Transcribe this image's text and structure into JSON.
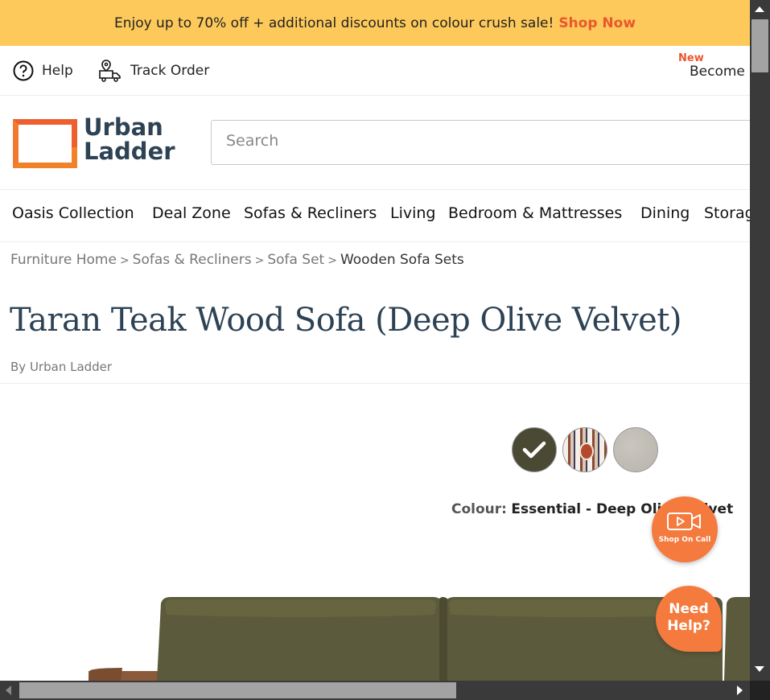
{
  "promo": {
    "text": "Enjoy up to 70% off + additional discounts on colour crush sale!",
    "cta": "Shop Now"
  },
  "utility": {
    "help": "Help",
    "track_order": "Track Order",
    "new_badge": "New",
    "become": "Become"
  },
  "header": {
    "logo_line1": "Urban",
    "logo_line2": "Ladder",
    "search_placeholder": "Search"
  },
  "nav": {
    "items": [
      "Oasis Collection",
      "Deal Zone",
      "Sofas & Recliners",
      "Living",
      "Bedroom & Mattresses",
      "Dining",
      "Storage"
    ]
  },
  "breadcrumb": {
    "items": [
      "Furniture Home",
      "Sofas & Recliners",
      "Sofa Set",
      "Wooden Sofa Sets"
    ],
    "separator": ">"
  },
  "product": {
    "title": "Taran Teak Wood Sofa (Deep Olive Velvet)",
    "by_prefix": "By",
    "brand": "Urban Ladder",
    "colour_label": "Colour:",
    "colour_value": "Essential - Deep Olive Velvet",
    "swatches": [
      {
        "name": "deep-olive-velvet",
        "selected": true
      },
      {
        "name": "patterned-fabric",
        "selected": false
      },
      {
        "name": "grey-fabric",
        "selected": false
      }
    ]
  },
  "floating": {
    "shop_on_call": "Shop On Call",
    "need_help_line1": "Need",
    "need_help_line2": "Help?"
  },
  "colors": {
    "promo_bg": "#fdc95b",
    "accent": "#e8582e",
    "brand_text": "#2e4255",
    "fab": "#f47a3e",
    "sofa": "#5b5a3c"
  }
}
